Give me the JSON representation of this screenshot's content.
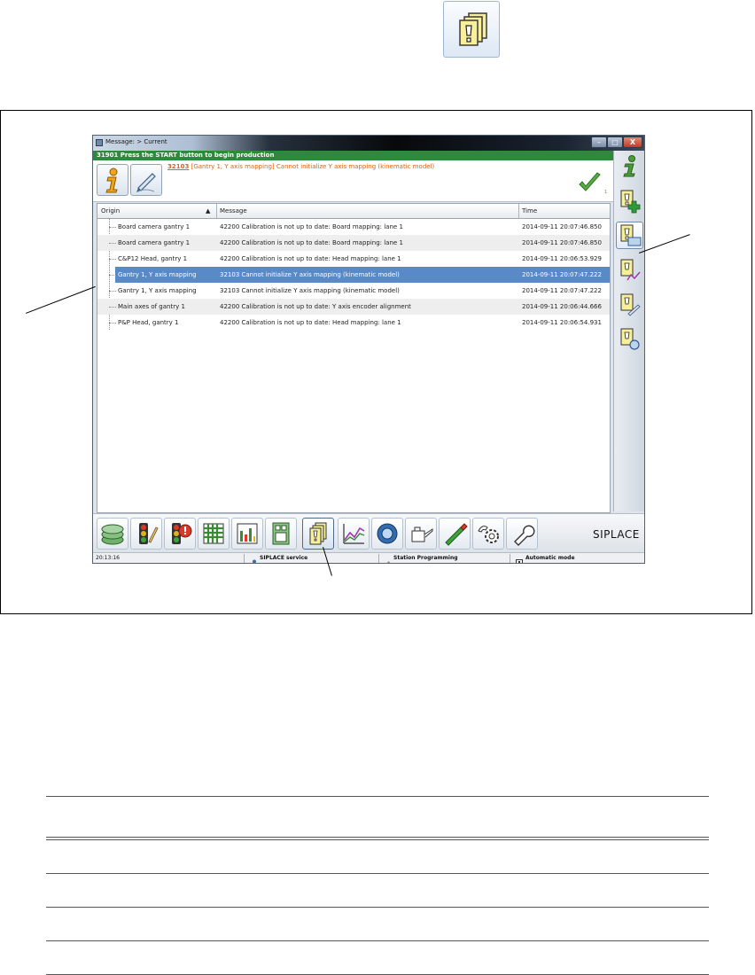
{
  "window": {
    "title": "Message: > Current",
    "minimize_label": "–",
    "maximize_label": "□",
    "close_label": "X"
  },
  "status_banner": "31901 Press the START button to begin production",
  "current_message": {
    "code": "32103",
    "text": " [Gantry 1, Y axis mapping] Cannot initialize Y axis mapping (kinematic model)",
    "ack_count": "1"
  },
  "table": {
    "headers": {
      "origin": "Origin",
      "message": "Message",
      "time": "Time"
    },
    "sort_indicator": "▲",
    "rows": [
      {
        "origin": "Board camera gantry 1",
        "message": "42200 Calibration is not up to date: Board mapping: lane 1",
        "time": "2014-09-11 20:07:46.850"
      },
      {
        "origin": "Board camera gantry 1",
        "message": "42200 Calibration is not up to date: Board mapping: lane 1",
        "time": "2014-09-11 20:07:46.850"
      },
      {
        "origin": "C&P12 Head, gantry 1",
        "message": "42200 Calibration is not up to date: Head mapping: lane 1",
        "time": "2014-09-11 20:06:53.929"
      },
      {
        "origin": "Gantry 1, Y axis mapping",
        "message": "32103 Cannot initialize Y axis mapping (kinematic model)",
        "time": "2014-09-11 20:07:47.222"
      },
      {
        "origin": "Gantry 1, Y axis mapping",
        "message": "32103 Cannot initialize Y axis mapping (kinematic model)",
        "time": "2014-09-11 20:07:47.222"
      },
      {
        "origin": "Main axes of gantry 1",
        "message": "42200 Calibration is not up to date: Y axis encoder alignment",
        "time": "2014-09-11 20:06:44.666"
      },
      {
        "origin": "P&P Head, gantry 1",
        "message": "42200 Calibration is not up to date: Head mapping: lane 1",
        "time": "2014-09-11 20:06:54.931"
      }
    ],
    "selected_row": 3
  },
  "brand": "SIPLACE",
  "status_bar": {
    "time": "20:13:16",
    "service": "SIPLACE service",
    "station": "Station Programming",
    "mode": "Automatic mode"
  },
  "colors": {
    "banner_green": "#2e8a3a",
    "alert_orange": "#e0620b",
    "selection_blue": "#5a89c8"
  }
}
